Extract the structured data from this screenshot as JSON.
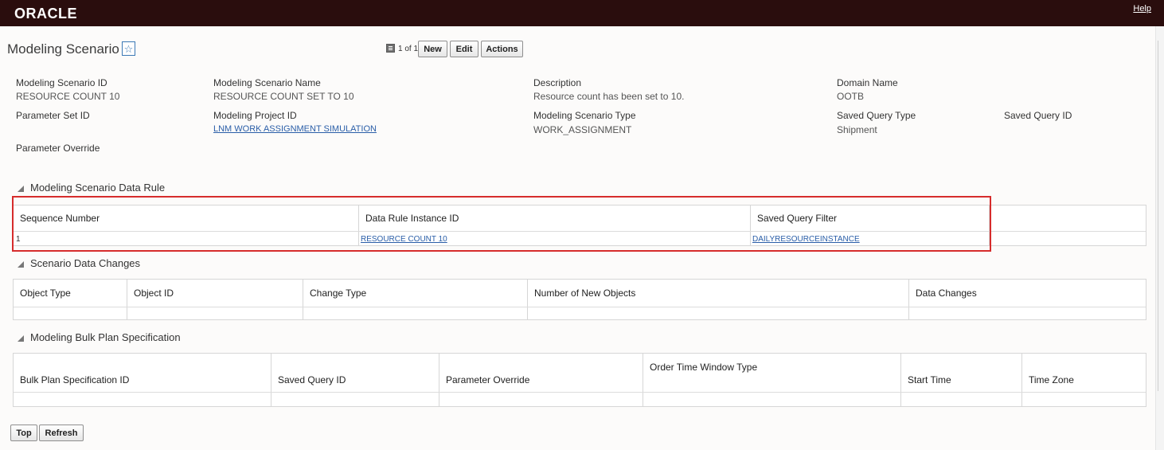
{
  "header": {
    "brand": "ORACLE",
    "help": "Help"
  },
  "page": {
    "title": "Modeling Scenario"
  },
  "toolbar": {
    "pager": "1 of 1",
    "new_label": "New",
    "edit_label": "Edit",
    "actions_label": "Actions"
  },
  "fields": {
    "scenario_id_label": "Modeling Scenario ID",
    "scenario_id_value": "RESOURCE COUNT 10",
    "scenario_name_label": "Modeling Scenario Name",
    "scenario_name_value": "RESOURCE COUNT SET TO 10",
    "description_label": "Description",
    "description_value": "Resource count has been set to 10.",
    "domain_label": "Domain Name",
    "domain_value": "OOTB",
    "parameter_set_label": "Parameter Set ID",
    "project_label": "Modeling Project ID",
    "project_value": "LNM WORK ASSIGNMENT SIMULATION",
    "scenario_type_label": "Modeling Scenario Type",
    "scenario_type_value": "WORK_ASSIGNMENT",
    "saved_query_type_label": "Saved Query Type",
    "saved_query_type_value": "Shipment",
    "saved_query_id_label": "Saved Query ID",
    "parameter_override_label": "Parameter Override"
  },
  "data_rule": {
    "title": "Modeling Scenario Data Rule",
    "columns": [
      "Sequence Number",
      "Data Rule Instance ID",
      "Saved Query Filter"
    ],
    "rows": [
      {
        "seq": "1",
        "instance": "RESOURCE COUNT 10",
        "filter": "DAILYRESOURCEINSTANCE"
      }
    ]
  },
  "data_changes": {
    "title": "Scenario Data Changes",
    "columns": [
      "Object Type",
      "Object ID",
      "Change Type",
      "Number of New Objects",
      "Data Changes"
    ]
  },
  "bulk_plan": {
    "title": "Modeling Bulk Plan Specification",
    "columns": [
      "Bulk Plan Specification ID",
      "Saved Query ID",
      "Parameter Override",
      "Order Time Window Type",
      "Start Time",
      "Time Zone"
    ]
  },
  "footer": {
    "top_label": "Top",
    "refresh_label": "Refresh"
  },
  "colors": {
    "topbar": "#2a0d0d",
    "link": "#2a5ea8",
    "highlight": "#d62c2c"
  }
}
